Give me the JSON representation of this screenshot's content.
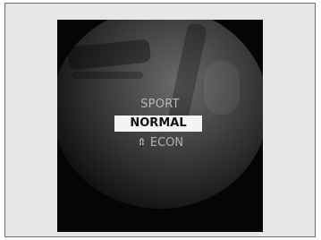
{
  "drive_mode_menu": {
    "options": [
      {
        "label": "SPORT",
        "selected": false
      },
      {
        "label": "NORMAL",
        "selected": true
      },
      {
        "label": "ECON",
        "selected": false,
        "icon": "leaf-icon"
      }
    ]
  }
}
